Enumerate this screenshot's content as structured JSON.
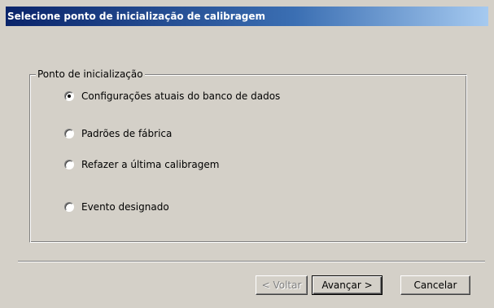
{
  "dialog": {
    "title": "Selecione ponto de inicialização de calibragem"
  },
  "group": {
    "legend": "Ponto de inicialização",
    "options": [
      {
        "label": "Configurações atuais do banco de dados",
        "selected": true
      },
      {
        "label": "Padrões de fábrica",
        "selected": false
      },
      {
        "label": "Refazer a última calibragem",
        "selected": false
      },
      {
        "label": "Evento designado",
        "selected": false
      }
    ]
  },
  "buttons": {
    "back": {
      "label": "< Voltar",
      "enabled": false
    },
    "next": {
      "label": "Avançar >",
      "enabled": true,
      "default": true
    },
    "cancel": {
      "label": "Cancelar",
      "enabled": true
    }
  },
  "colors": {
    "title_bar_start": "#0a246a",
    "title_bar_end": "#a6caf0",
    "dialog_background": "#d4d0c8"
  }
}
